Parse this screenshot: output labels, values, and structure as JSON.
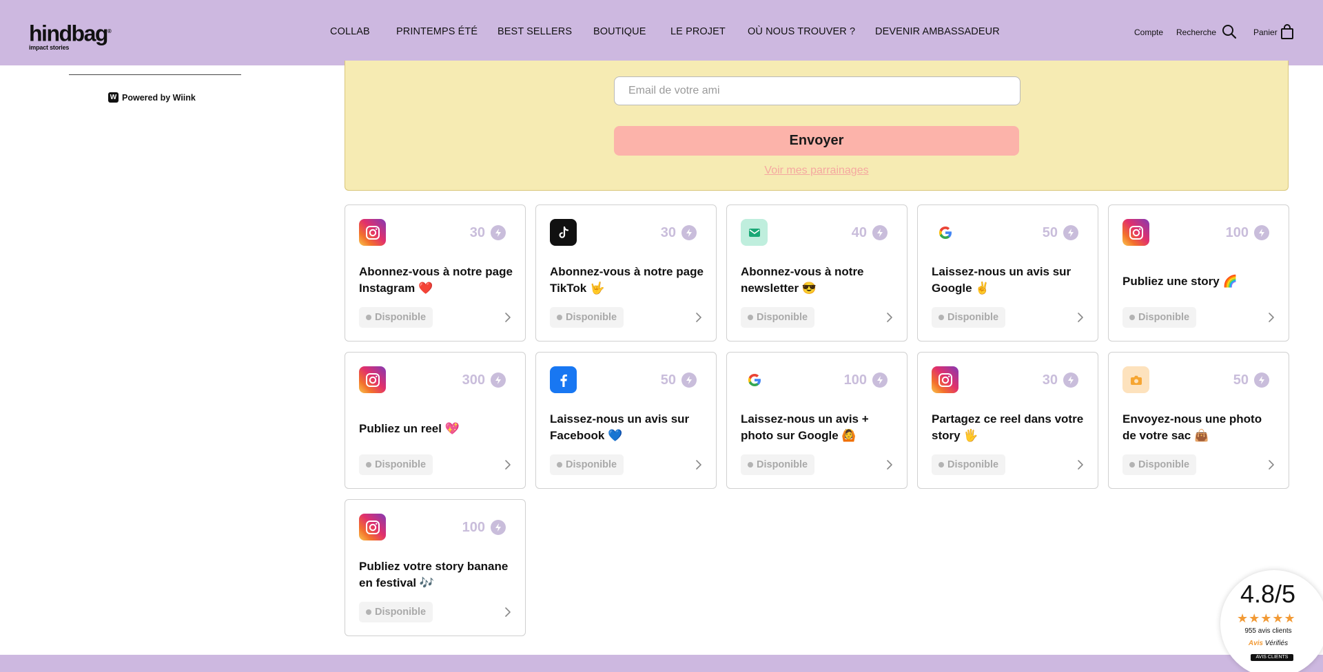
{
  "header": {
    "logo": "hindbag",
    "logo_sub": "impact stories",
    "nav": [
      "COLLAB",
      "PRINTEMPS ÉTÉ",
      "BEST SELLERS",
      "BOUTIQUE",
      "LE PROJET",
      "OÙ NOUS TROUVER ?",
      "DEVENIR AMBASSADEUR"
    ],
    "account": "Compte",
    "search": "Recherche",
    "cart": "Panier"
  },
  "sidebar": {
    "powered_by": "Powered by Wiink"
  },
  "referral": {
    "email_placeholder": "Email de votre ami",
    "send_label": "Envoyer",
    "see_link": "Voir mes parrainages"
  },
  "actions": [
    {
      "icon": "instagram-icon",
      "points": "30",
      "title": "Abonnez-vous à notre page Instagram ❤️",
      "status": "Disponible"
    },
    {
      "icon": "tiktok-icon",
      "points": "30",
      "title": "Abonnez-vous à notre page TikTok 🤟",
      "status": "Disponible"
    },
    {
      "icon": "newsletter-icon",
      "points": "40",
      "title": "Abonnez-vous à notre newsletter 😎",
      "status": "Disponible"
    },
    {
      "icon": "google-icon",
      "points": "50",
      "title": "Laissez-nous un avis sur Google ✌️",
      "status": "Disponible"
    },
    {
      "icon": "instagram-icon",
      "points": "100",
      "title": "Publiez une story 🌈",
      "status": "Disponible"
    },
    {
      "icon": "instagram-icon",
      "points": "300",
      "title": "Publiez un reel 💖",
      "status": "Disponible"
    },
    {
      "icon": "facebook-icon",
      "points": "50",
      "title": "Laissez-nous un avis sur Facebook 💙",
      "status": "Disponible"
    },
    {
      "icon": "google-icon",
      "points": "100",
      "title": "Laissez-nous un avis + photo sur Google 🙆",
      "status": "Disponible"
    },
    {
      "icon": "instagram-icon",
      "points": "30",
      "title": "Partagez ce reel dans votre story 🖐️",
      "status": "Disponible"
    },
    {
      "icon": "camera-icon",
      "points": "50",
      "title": "Envoyez-nous une photo de votre sac 👜",
      "status": "Disponible"
    },
    {
      "icon": "instagram-icon",
      "points": "100",
      "title": "Publiez votre story banane en festival 🎶",
      "status": "Disponible"
    }
  ],
  "rating": {
    "score": "4.8/5",
    "stars": "★★★★★",
    "count": "955 avis clients",
    "brand_a": "Avis",
    "brand_b": "Vérifiés",
    "brand_sub": "AVIS CLIENTS"
  }
}
